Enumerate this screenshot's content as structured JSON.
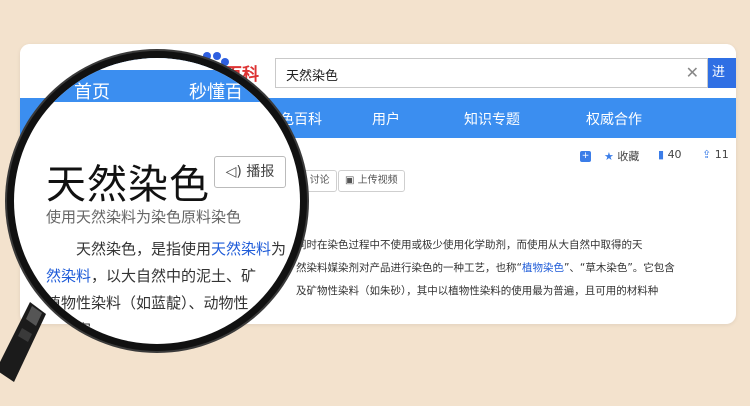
{
  "header": {
    "logo_text": "百科",
    "search_value": "天然染色",
    "search_button": "进",
    "clear_icon": "✕"
  },
  "nav": {
    "items": [
      "首页",
      "秒懂百",
      "染色百科",
      "用户",
      "知识专题",
      "权威合作"
    ]
  },
  "tools": {
    "collect": "收藏",
    "likes": "40",
    "share_count": "11"
  },
  "pills": {
    "discuss": "讨论",
    "upload": "上传视频"
  },
  "article": {
    "title": "天然染色",
    "play_label": "播报",
    "subtitle": "使用天然染料为染色原料染色",
    "lens_text": "天然染色，是指使用天然染料为染色原料，以大自然中的泥土、矿物性染料（如蓝靛）、动物性染料……丰富。",
    "body_line1": "同时在染色过程中不使用或极少使用化学助剂，而使用从大自然中取得的天",
    "body_line2a": "然染料媒染剂对产品进行染色的一种工艺，也称“",
    "body_link1": "植物染色",
    "body_line2b": "”、“草木染色”。它包含",
    "body_line3": "及矿物性染料（如朱砂），其中以植物性染料的使用最为普遍，且可用的材料种",
    "lens_line1a": "天然染色，是指使用",
    "lens_link": "天然染料",
    "lens_line1b": "为",
    "lens_line2a": "然染料",
    "lens_line2b": "，以大自然中的泥土、矿",
    "lens_line3": "植物性染料（如蓝靛）、动物性",
    "lens_line4": "最丰富。"
  },
  "colors": {
    "nav_blue": "#3b8ef0",
    "link_blue": "#1e5bd8",
    "search_blue": "#2f6fe4",
    "background": "#f3e2cd"
  }
}
